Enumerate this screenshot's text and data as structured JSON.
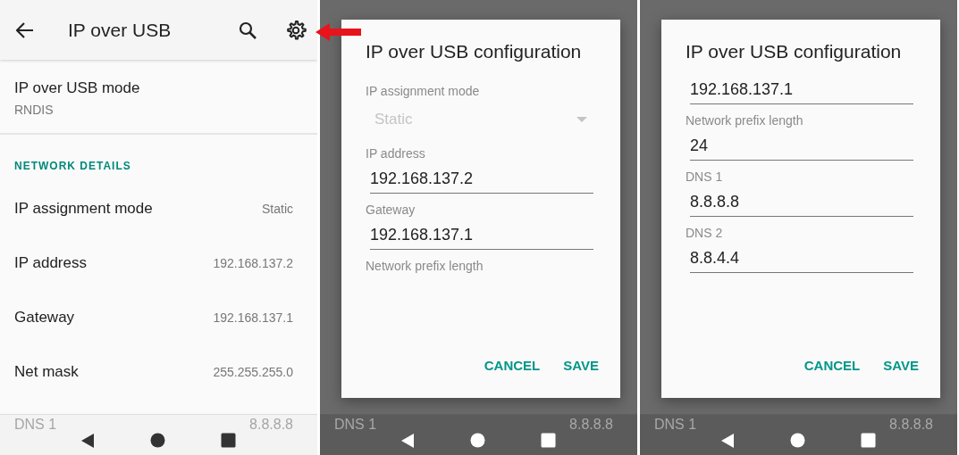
{
  "screens": [
    {
      "kind": "settings",
      "app_bar": {
        "title": "IP over USB"
      },
      "mode": {
        "title": "IP over USB mode",
        "summary": "RNDIS"
      },
      "section_header": "NETWORK DETAILS",
      "details": [
        {
          "label": "IP assignment mode",
          "value": "Static"
        },
        {
          "label": "IP address",
          "value": "192.168.137.2"
        },
        {
          "label": "Gateway",
          "value": "192.168.137.1"
        },
        {
          "label": "Net mask",
          "value": "255.255.255.0"
        }
      ],
      "under_nav": {
        "label": "DNS 1",
        "value": "8.8.8.8"
      }
    },
    {
      "kind": "dialog",
      "dialog": {
        "title": "IP over USB configuration",
        "fields": [
          {
            "kind": "label",
            "text": "IP assignment mode"
          },
          {
            "kind": "dropdown",
            "value": "Static",
            "disabled": true
          },
          {
            "kind": "label",
            "text": "IP address"
          },
          {
            "kind": "input",
            "value": "192.168.137.2"
          },
          {
            "kind": "label",
            "text": "Gateway"
          },
          {
            "kind": "input",
            "value": "192.168.137.1"
          },
          {
            "kind": "label",
            "text": "Network prefix length"
          }
        ],
        "buttons": [
          "CANCEL",
          "SAVE"
        ]
      },
      "under_nav": {
        "label": "DNS 1",
        "value": "8.8.8.8"
      }
    },
    {
      "kind": "dialog",
      "dialog": {
        "title": "IP over USB configuration",
        "fields": [
          {
            "kind": "input",
            "value": "192.168.137.1"
          },
          {
            "kind": "label",
            "text": "Network prefix length"
          },
          {
            "kind": "input",
            "value": "24"
          },
          {
            "kind": "label",
            "text": "DNS 1"
          },
          {
            "kind": "input",
            "value": "8.8.8.8"
          },
          {
            "kind": "label",
            "text": "DNS 2"
          },
          {
            "kind": "input",
            "value": "8.8.4.4"
          }
        ],
        "buttons": [
          "CANCEL",
          "SAVE"
        ]
      },
      "under_nav": {
        "label": "DNS 1",
        "value": "8.8.8.8"
      }
    }
  ]
}
